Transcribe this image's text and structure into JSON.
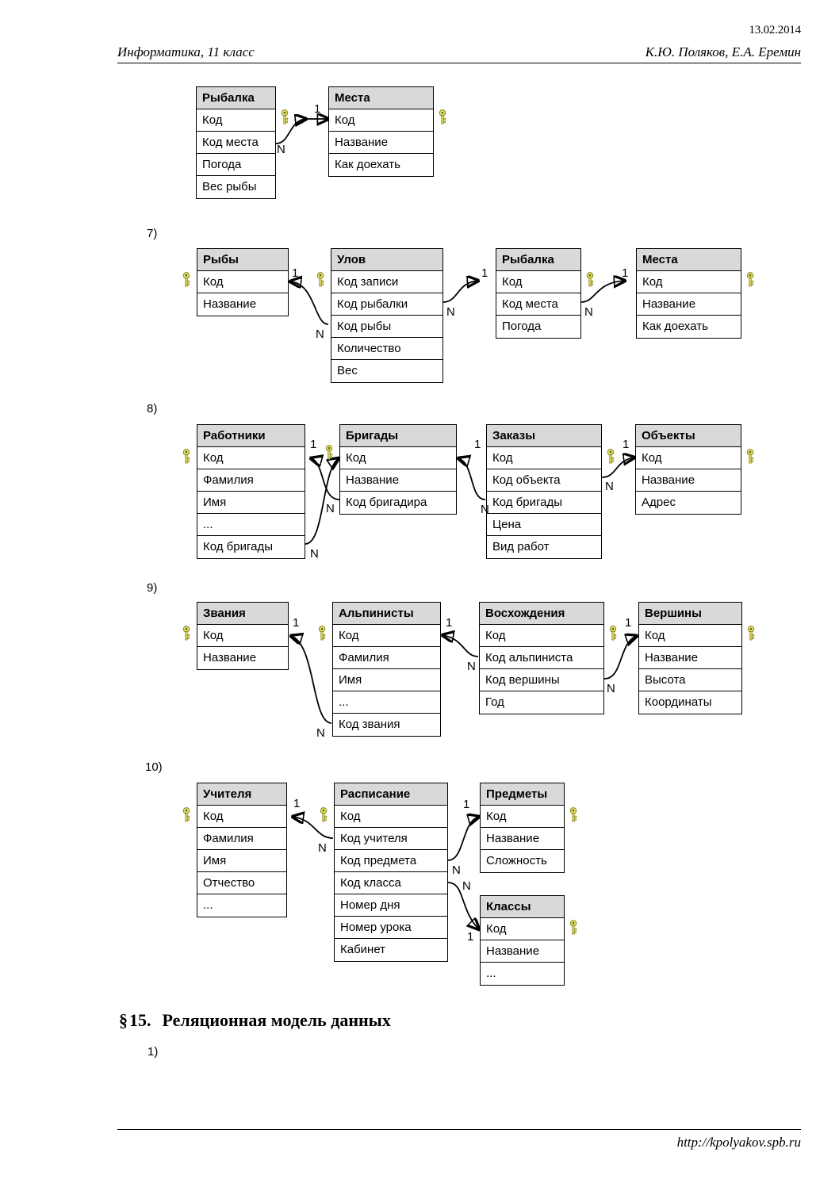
{
  "header": {
    "date": "13.02.2014",
    "course": "Информатика, 11 класс",
    "authors": "К.Ю. Поляков, Е.А. Еремин"
  },
  "footer": {
    "url": "http://kpolyakov.spb.ru"
  },
  "section": {
    "paragraph_symbol": "§",
    "number": "15.",
    "title": "Реляционная модель данных",
    "item_1": "1)"
  },
  "icons": {
    "key": "key-icon"
  },
  "cardinality": {
    "one": "1",
    "many": "N"
  },
  "diagrams": [
    {
      "index": "",
      "entities": [
        {
          "name": "Рыбалка",
          "fields": [
            "Код",
            "Код места",
            "Погода",
            "Вес рыбы"
          ]
        },
        {
          "name": "Места",
          "fields": [
            "Код",
            "Название",
            "Как доехать"
          ]
        }
      ],
      "links": [
        {
          "from": "Рыбалка.Код места",
          "to": "Места.Код",
          "from_card": "N",
          "to_card": "1"
        }
      ]
    },
    {
      "index": "7)",
      "entities": [
        {
          "name": "Рыбы",
          "fields": [
            "Код",
            "Название"
          ]
        },
        {
          "name": "Улов",
          "fields": [
            "Код записи",
            "Код рыбалки",
            "Код рыбы",
            "Количество",
            "Вес"
          ]
        },
        {
          "name": "Рыбалка",
          "fields": [
            "Код",
            "Код места",
            "Погода"
          ]
        },
        {
          "name": "Места",
          "fields": [
            "Код",
            "Название",
            "Как доехать"
          ]
        }
      ],
      "links": [
        {
          "from": "Улов.Код рыбы",
          "to": "Рыбы.Код",
          "from_card": "N",
          "to_card": "1"
        },
        {
          "from": "Улов.Код рыбалки",
          "to": "Рыбалка.Код",
          "from_card": "N",
          "to_card": "1"
        },
        {
          "from": "Рыбалка.Код места",
          "to": "Места.Код",
          "from_card": "N",
          "to_card": "1"
        }
      ]
    },
    {
      "index": "8)",
      "entities": [
        {
          "name": "Работники",
          "fields": [
            "Код",
            "Фамилия",
            "Имя",
            "...",
            "Код бригады"
          ]
        },
        {
          "name": "Бригады",
          "fields": [
            "Код",
            "Название",
            "Код бригадира"
          ]
        },
        {
          "name": "Заказы",
          "fields": [
            "Код",
            "Код объекта",
            "Код бригады",
            "Цена",
            "Вид работ"
          ]
        },
        {
          "name": "Объекты",
          "fields": [
            "Код",
            "Название",
            "Адрес"
          ]
        }
      ],
      "links": [
        {
          "from": "Бригады.Код бригадира",
          "to": "Работники.Код",
          "from_card": "N",
          "to_card": "1"
        },
        {
          "from": "Работники.Код бригады",
          "to": "Бригады.Код",
          "from_card": "N",
          "to_card": "1"
        },
        {
          "from": "Заказы.Код бригады",
          "to": "Бригады.Код",
          "from_card": "N",
          "to_card": "1"
        },
        {
          "from": "Заказы.Код объекта",
          "to": "Объекты.Код",
          "from_card": "N",
          "to_card": "1"
        }
      ]
    },
    {
      "index": "9)",
      "entities": [
        {
          "name": "Звания",
          "fields": [
            "Код",
            "Название"
          ]
        },
        {
          "name": "Альпинисты",
          "fields": [
            "Код",
            "Фамилия",
            "Имя",
            "...",
            "Код звания"
          ]
        },
        {
          "name": "Восхождения",
          "fields": [
            "Код",
            "Код альпиниста",
            "Код вершины",
            "Год"
          ]
        },
        {
          "name": "Вершины",
          "fields": [
            "Код",
            "Название",
            "Высота",
            "Координаты"
          ]
        }
      ],
      "links": [
        {
          "from": "Альпинисты.Код звания",
          "to": "Звания.Код",
          "from_card": "N",
          "to_card": "1"
        },
        {
          "from": "Восхождения.Код альпиниста",
          "to": "Альпинисты.Код",
          "from_card": "N",
          "to_card": "1"
        },
        {
          "from": "Восхождения.Код вершины",
          "to": "Вершины.Код",
          "from_card": "N",
          "to_card": "1"
        }
      ]
    },
    {
      "index": "10)",
      "entities": [
        {
          "name": "Учителя",
          "fields": [
            "Код",
            "Фамилия",
            "Имя",
            "Отчество",
            "..."
          ]
        },
        {
          "name": "Расписание",
          "fields": [
            "Код",
            "Код учителя",
            "Код предмета",
            "Код класса",
            "Номер дня",
            "Номер урока",
            "Кабинет"
          ]
        },
        {
          "name": "Предметы",
          "fields": [
            "Код",
            "Название",
            "Сложность"
          ]
        },
        {
          "name": "Классы",
          "fields": [
            "Код",
            "Название",
            "..."
          ]
        }
      ],
      "links": [
        {
          "from": "Расписание.Код учителя",
          "to": "Учителя.Код",
          "from_card": "N",
          "to_card": "1"
        },
        {
          "from": "Расписание.Код предмета",
          "to": "Предметы.Код",
          "from_card": "N",
          "to_card": "1"
        },
        {
          "from": "Расписание.Код класса",
          "to": "Классы.Код",
          "from_card": "N",
          "to_card": "1"
        }
      ]
    }
  ]
}
